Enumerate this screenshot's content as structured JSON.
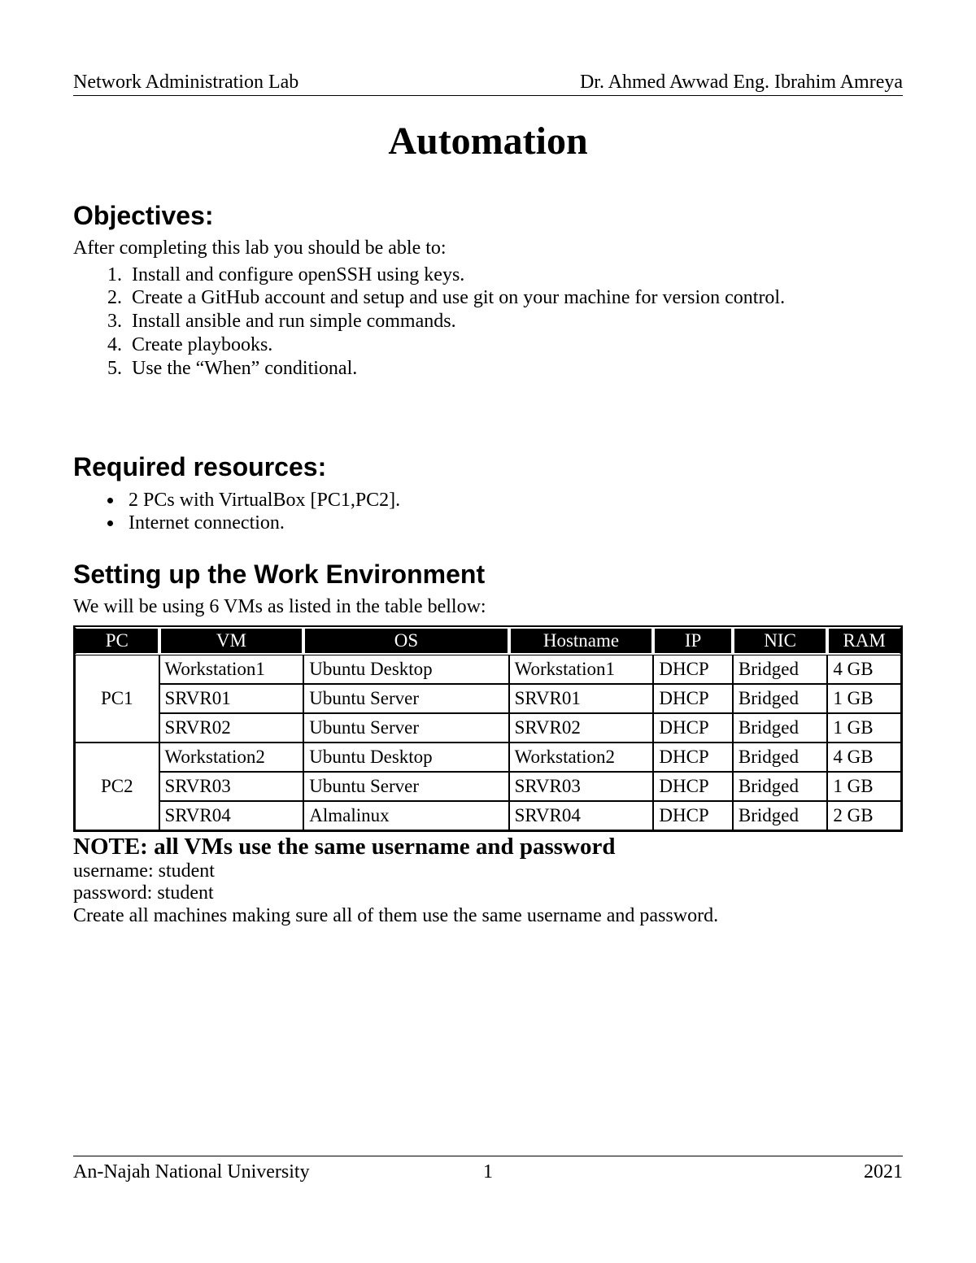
{
  "header": {
    "left": "Network Administration Lab",
    "right": "Dr. Ahmed Awwad  Eng. Ibrahim Amreya"
  },
  "title": "Automation",
  "sections": {
    "objectives": {
      "heading": "Objectives:",
      "intro": "After completing this lab you should be able to:",
      "items": [
        "Install and configure openSSH using keys.",
        "Create a GitHub account and setup and use git on your machine for version control.",
        "Install ansible and run simple commands.",
        "Create playbooks.",
        "Use the “When” conditional."
      ]
    },
    "resources": {
      "heading": "Required resources:",
      "items": [
        "2 PCs with VirtualBox [PC1,PC2].",
        "Internet connection."
      ]
    },
    "setup": {
      "heading": "Setting up the Work Environment",
      "intro": "We will be using 6 VMs as listed in the table bellow:"
    }
  },
  "table": {
    "headers": [
      "PC",
      "VM",
      "OS",
      "Hostname",
      "IP",
      "NIC",
      "RAM"
    ],
    "groups": [
      {
        "pc": "PC1",
        "rows": [
          {
            "vm": "Workstation1",
            "os": "Ubuntu Desktop",
            "host": "Workstation1",
            "ip": "DHCP",
            "nic": "Bridged",
            "ram": "4 GB"
          },
          {
            "vm": "SRVR01",
            "os": "Ubuntu Server",
            "host": "SRVR01",
            "ip": "DHCP",
            "nic": "Bridged",
            "ram": "1 GB"
          },
          {
            "vm": "SRVR02",
            "os": "Ubuntu Server",
            "host": "SRVR02",
            "ip": "DHCP",
            "nic": "Bridged",
            "ram": "1 GB"
          }
        ]
      },
      {
        "pc": "PC2",
        "rows": [
          {
            "vm": "Workstation2",
            "os": "Ubuntu Desktop",
            "host": "Workstation2",
            "ip": "DHCP",
            "nic": "Bridged",
            "ram": "4 GB"
          },
          {
            "vm": "SRVR03",
            "os": "Ubuntu Server",
            "host": "SRVR03",
            "ip": "DHCP",
            "nic": "Bridged",
            "ram": "1 GB"
          },
          {
            "vm": "SRVR04",
            "os": "Almalinux",
            "host": "SRVR04",
            "ip": "DHCP",
            "nic": "Bridged",
            "ram": "2 GB"
          }
        ]
      }
    ]
  },
  "note": {
    "heading": "NOTE: all  VMs use the same username and password",
    "username_line": "username: student",
    "password_line": "password: student",
    "instruction": "Create all  machines making sure all of them use the same username and password."
  },
  "footer": {
    "left": "An-Najah National University",
    "center": "1",
    "right": "2021"
  }
}
